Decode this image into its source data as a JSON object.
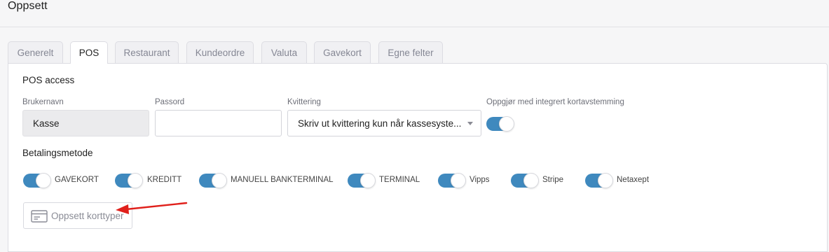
{
  "page": {
    "title": "Oppsett"
  },
  "tabs": [
    {
      "label": "Generelt",
      "active": false
    },
    {
      "label": "POS",
      "active": true
    },
    {
      "label": "Restaurant",
      "active": false
    },
    {
      "label": "Kundeordre",
      "active": false
    },
    {
      "label": "Valuta",
      "active": false
    },
    {
      "label": "Gavekort",
      "active": false
    },
    {
      "label": "Egne felter",
      "active": false
    }
  ],
  "pos_access": {
    "section_title": "POS access",
    "username": {
      "label": "Brukernavn",
      "value": "Kasse",
      "disabled": true
    },
    "password": {
      "label": "Passord",
      "value": ""
    },
    "receipt": {
      "label": "Kvittering",
      "value": "Skriv ut kvittering kun når kassesyste..."
    },
    "settlement": {
      "label": "Oppgjør med integrert kortavstemming",
      "enabled": true
    }
  },
  "payment_methods": {
    "section_title": "Betalingsmetode",
    "items": [
      {
        "label": "GAVEKORT",
        "enabled": true
      },
      {
        "label": "KREDITT",
        "enabled": true
      },
      {
        "label": "MANUELL BANKTERMINAL",
        "enabled": true
      },
      {
        "label": "TERMINAL",
        "enabled": true
      },
      {
        "label": "Vipps",
        "enabled": true
      },
      {
        "label": "Stripe",
        "enabled": true
      },
      {
        "label": "Netaxept",
        "enabled": true
      }
    ]
  },
  "card_types_button": {
    "label": "Oppsett korttyper",
    "icon": "credit-card-icon"
  },
  "colors": {
    "toggle_on": "#3f89be",
    "annotation_arrow": "#e0201b"
  }
}
